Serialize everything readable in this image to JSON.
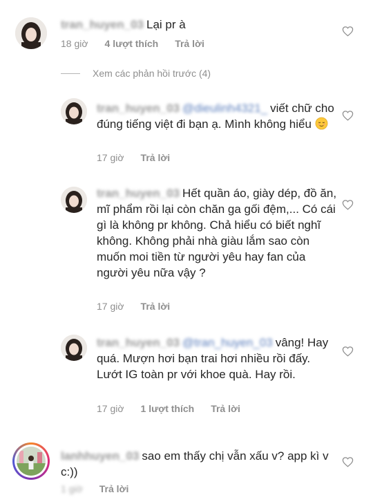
{
  "comments": [
    {
      "username": "tran_huyen_03",
      "text": "Lại pr à",
      "time": "18 giờ",
      "likes": "4 lượt thích",
      "reply": "Trả lời"
    }
  ],
  "view_previous": "Xem các phản hồi trước (4)",
  "replies": [
    {
      "username": "tran_huyen_03",
      "mention": "@dieulinh4321_",
      "text": "viết chữ cho đúng tiếng việt đi bạn ạ. Mình không hiểu",
      "time": "17 giờ",
      "reply": "Trả lời"
    },
    {
      "username": "tran_huyen_03",
      "text": "Hết quần áo, giày dép, đồ ăn, mĩ phẩm rồi lại còn chăn ga gối đệm,... Có cái gì là không pr không. Chả hiểu có biết nghĩ không. Không phải nhà giàu lắm sao còn muốn moi tiền từ người yêu hay fan của người yêu nữa vậy ?",
      "time": "17 giờ",
      "reply": "Trả lời"
    },
    {
      "username": "tran_huyen_03",
      "mention": "@tran_huyen_03",
      "text": "vâng! Hay quá. Mượn hơi bạn trai hơi nhiều rồi đấy. Lướt IG toàn pr với khoe quà. Hay rồi.",
      "time": "17 giờ",
      "likes": "1 lượt thích",
      "reply": "Trả lời"
    }
  ],
  "bottom_comment": {
    "username": "lanhhuyen_03",
    "text": "sao em thấy chị vẫn xấu v? app kì v c:))",
    "time": "1 giờ",
    "reply": "Trả lời"
  },
  "icons": {
    "heart": "heart-outline-icon",
    "emoji": "relieved-face-emoji"
  },
  "colors": {
    "text": "#262626",
    "meta": "#8e8e8e",
    "mention": "#5c7fbd",
    "heart": "#8e8e8e"
  }
}
